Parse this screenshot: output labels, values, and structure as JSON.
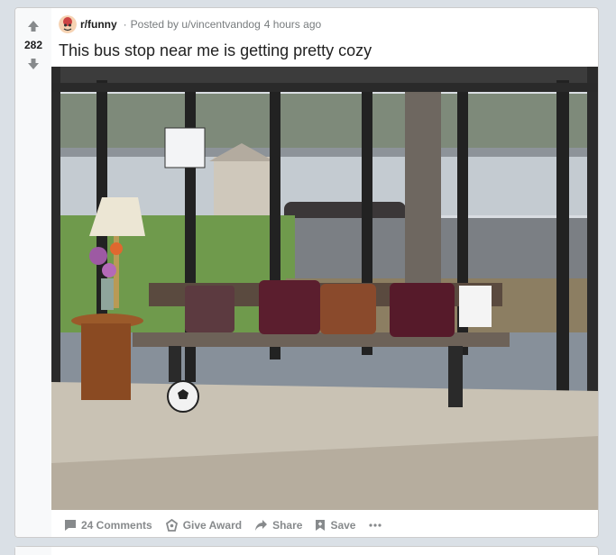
{
  "post": {
    "vote_count": "282",
    "subreddit": "r/funny",
    "posted_by": "Posted by u/vincentvandog",
    "time_ago": "4 hours ago",
    "title": "This bus stop near me is getting pretty cozy",
    "media_icon": "image"
  },
  "actions": {
    "comments": "24 Comments",
    "award": "Give Award",
    "share": "Share",
    "save": "Save"
  },
  "colors": {
    "accent": "#0079d3",
    "upvote_gray": "#878a8c"
  }
}
